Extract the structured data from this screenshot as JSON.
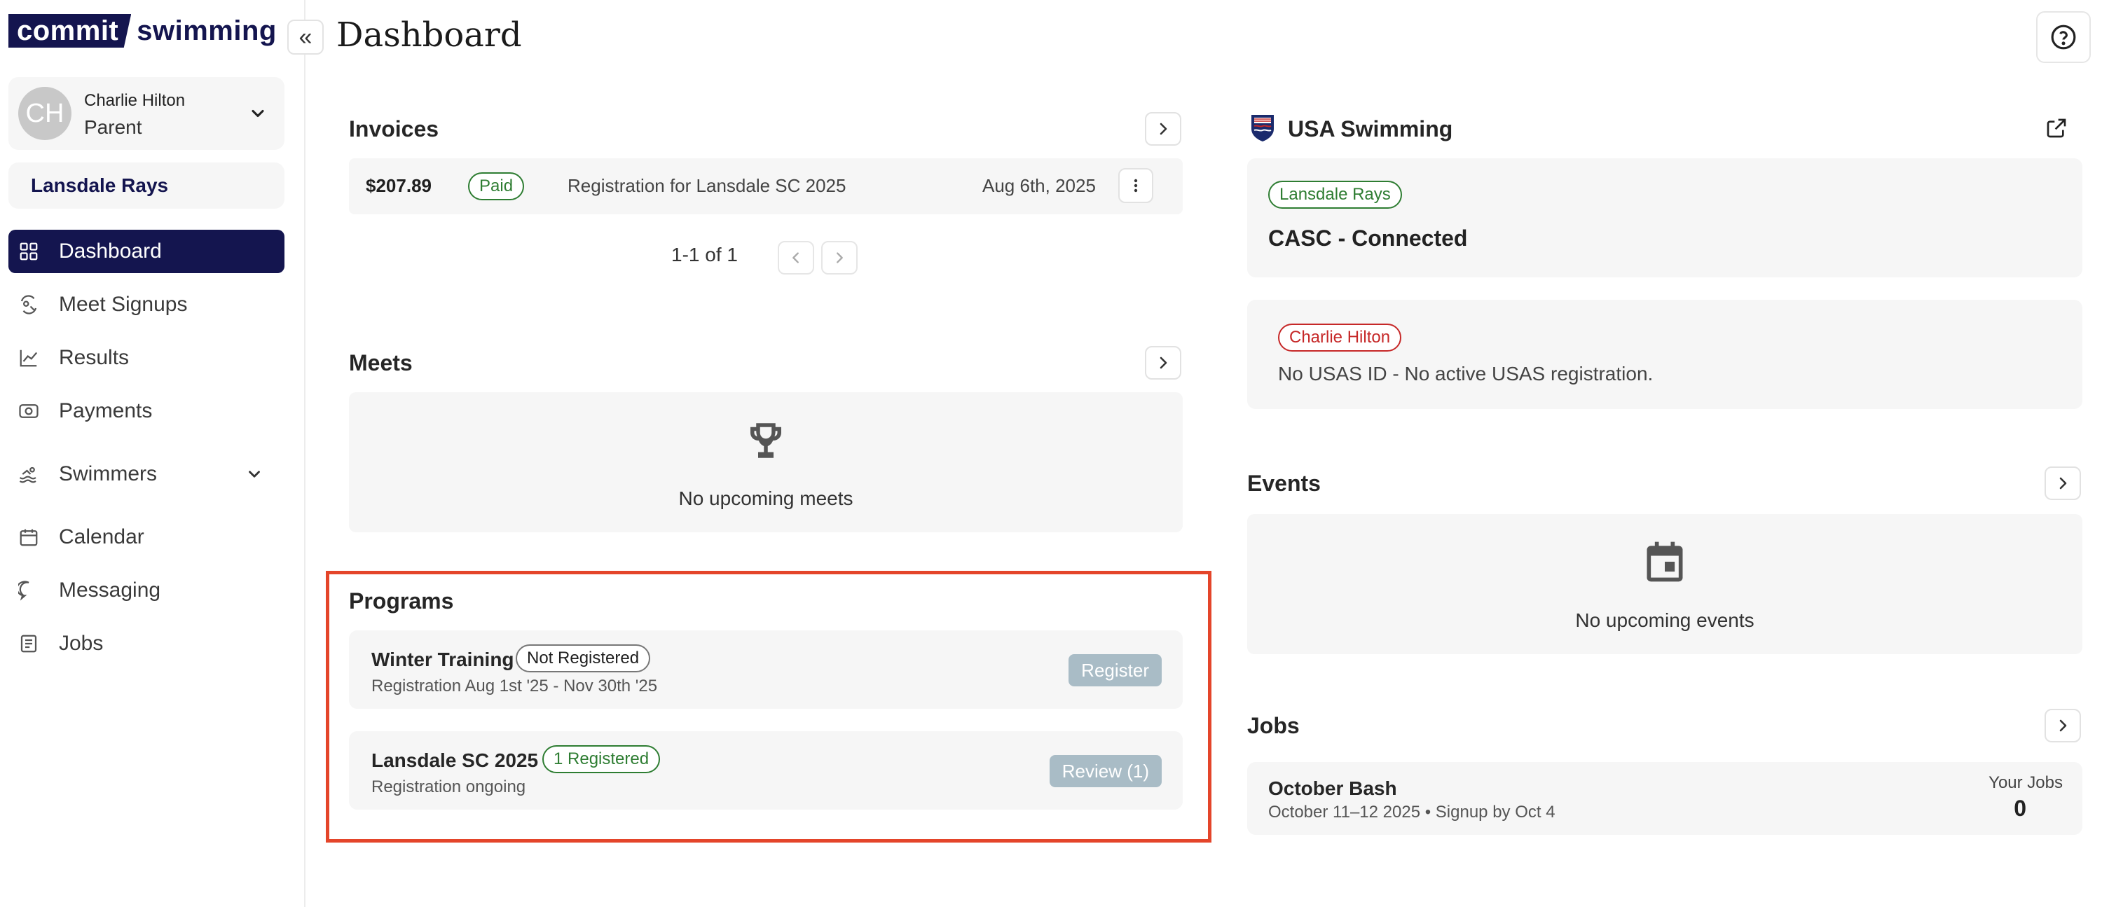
{
  "brand": {
    "part1": "commit",
    "part2": "swimming"
  },
  "sidebar": {
    "collapse_glyph": "«",
    "user": {
      "initials": "CH",
      "name": "Charlie Hilton",
      "role": "Parent"
    },
    "team": "Lansdale Rays",
    "items": [
      {
        "label": "Dashboard",
        "icon": "dashboard-icon"
      },
      {
        "label": "Meet Signups",
        "icon": "meet-signups-icon"
      },
      {
        "label": "Results",
        "icon": "results-chart-icon"
      },
      {
        "label": "Payments",
        "icon": "payments-icon"
      },
      {
        "label": "Swimmers",
        "icon": "swimmers-icon"
      },
      {
        "label": "Calendar",
        "icon": "calendar-icon"
      },
      {
        "label": "Messaging",
        "icon": "messaging-icon"
      },
      {
        "label": "Jobs",
        "icon": "jobs-icon"
      }
    ]
  },
  "header": {
    "title": "Dashboard"
  },
  "invoices": {
    "title": "Invoices",
    "rows": [
      {
        "amount": "$207.89",
        "status": "Paid",
        "description": "Registration for Lansdale SC 2025",
        "date": "Aug 6th, 2025"
      }
    ],
    "pager": "1-1 of 1"
  },
  "meets": {
    "title": "Meets",
    "empty": "No upcoming meets"
  },
  "programs": {
    "title": "Programs",
    "items": [
      {
        "name": "Winter Training",
        "badge": "Not Registered",
        "subtitle": "Registration Aug 1st '25 - Nov 30th '25",
        "action": "Register"
      },
      {
        "name": "Lansdale SC 2025",
        "badge": "1 Registered",
        "subtitle": "Registration ongoing",
        "action": "Review (1)"
      }
    ]
  },
  "usa": {
    "title": "USA Swimming",
    "club_badge": "Lansdale Rays",
    "club_status": "CASC - Connected",
    "member_badge": "Charlie Hilton",
    "member_status": "No USAS ID - No active USAS registration."
  },
  "events": {
    "title": "Events",
    "empty": "No upcoming events"
  },
  "jobs": {
    "title": "Jobs",
    "item": {
      "name": "October Bash",
      "subtitle": "October 11–12 2025 • Signup by Oct 4",
      "your_label": "Your Jobs",
      "count": "0"
    }
  },
  "colors": {
    "brand_navy": "#14154f",
    "highlight": "#e4452a",
    "paid_green": "#2e7d32",
    "alert_red": "#c62828",
    "action_disabled": "#a9bcc6"
  }
}
